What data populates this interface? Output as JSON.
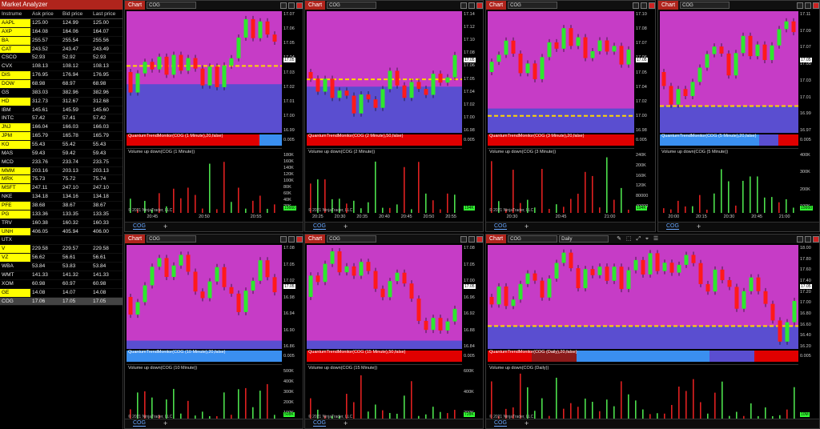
{
  "market_analyzer": {
    "title": "Market Analyzer",
    "columns": [
      "Instrume",
      "Ask price",
      "Bid price",
      "Last price"
    ],
    "rows": [
      {
        "sym": "AAPL",
        "ask": "125.00",
        "bid": "124.99",
        "last": "125.00",
        "hl": true
      },
      {
        "sym": "AXP",
        "ask": "164.08",
        "bid": "164.06",
        "last": "164.07",
        "hl": true
      },
      {
        "sym": "BA",
        "ask": "255.57",
        "bid": "255.54",
        "last": "255.56",
        "hl": true
      },
      {
        "sym": "CAT",
        "ask": "243.52",
        "bid": "243.47",
        "last": "243.49",
        "hl": true
      },
      {
        "sym": "CSCO",
        "ask": "52.93",
        "bid": "52.92",
        "last": "52.93",
        "hl": false
      },
      {
        "sym": "CVX",
        "ask": "108.13",
        "bid": "108.12",
        "last": "108.13",
        "hl": false
      },
      {
        "sym": "DIS",
        "ask": "176.95",
        "bid": "176.94",
        "last": "176.95",
        "hl": true
      },
      {
        "sym": "DOW",
        "ask": "68.98",
        "bid": "68.97",
        "last": "68.98",
        "hl": true
      },
      {
        "sym": "GS",
        "ask": "383.03",
        "bid": "382.96",
        "last": "382.96",
        "hl": false
      },
      {
        "sym": "HD",
        "ask": "312.73",
        "bid": "312.67",
        "last": "312.68",
        "hl": true
      },
      {
        "sym": "IBM",
        "ask": "145.61",
        "bid": "145.59",
        "last": "145.60",
        "hl": false
      },
      {
        "sym": "INTC",
        "ask": "57.42",
        "bid": "57.41",
        "last": "57.42",
        "hl": false
      },
      {
        "sym": "JNJ",
        "ask": "166.04",
        "bid": "166.03",
        "last": "166.03",
        "hl": true
      },
      {
        "sym": "JPM",
        "ask": "165.79",
        "bid": "165.78",
        "last": "165.79",
        "hl": true
      },
      {
        "sym": "KO",
        "ask": "55.43",
        "bid": "55.42",
        "last": "55.43",
        "hl": true
      },
      {
        "sym": "MAS",
        "ask": "59.43",
        "bid": "59.42",
        "last": "59.43",
        "hl": false
      },
      {
        "sym": "MCD",
        "ask": "233.76",
        "bid": "233.74",
        "last": "233.75",
        "hl": false
      },
      {
        "sym": "MMM",
        "ask": "203.16",
        "bid": "203.13",
        "last": "203.13",
        "hl": true
      },
      {
        "sym": "MRK",
        "ask": "75.73",
        "bid": "75.72",
        "last": "75.74",
        "hl": true
      },
      {
        "sym": "MSFT",
        "ask": "247.11",
        "bid": "247.10",
        "last": "247.10",
        "hl": true
      },
      {
        "sym": "NKE",
        "ask": "134.18",
        "bid": "134.16",
        "last": "134.18",
        "hl": false
      },
      {
        "sym": "PFE",
        "ask": "38.68",
        "bid": "38.67",
        "last": "38.67",
        "hl": true
      },
      {
        "sym": "PG",
        "ask": "133.36",
        "bid": "133.35",
        "last": "133.35",
        "hl": true
      },
      {
        "sym": "TRV",
        "ask": "160.38",
        "bid": "160.32",
        "last": "160.33",
        "hl": false
      },
      {
        "sym": "UNH",
        "ask": "406.05",
        "bid": "405.94",
        "last": "406.00",
        "hl": true
      },
      {
        "sym": "UTX",
        "ask": "",
        "bid": "",
        "last": "",
        "hl": false
      },
      {
        "sym": "V",
        "ask": "229.58",
        "bid": "229.57",
        "last": "229.58",
        "hl": true
      },
      {
        "sym": "VZ",
        "ask": "56.62",
        "bid": "56.61",
        "last": "56.61",
        "hl": true
      },
      {
        "sym": "WBA",
        "ask": "53.84",
        "bid": "53.83",
        "last": "53.84",
        "hl": false
      },
      {
        "sym": "WMT",
        "ask": "141.33",
        "bid": "141.32",
        "last": "141.33",
        "hl": false
      },
      {
        "sym": "XOM",
        "ask": "60.98",
        "bid": "60.97",
        "last": "60.98",
        "hl": false
      },
      {
        "sym": "GE",
        "ask": "14.08",
        "bid": "14.07",
        "last": "14.08",
        "hl": true
      },
      {
        "sym": "COG",
        "ask": "17.06",
        "bid": "17.05",
        "last": "17.05",
        "hl": false,
        "sel": true
      }
    ]
  },
  "charts": [
    {
      "label": "Chart",
      "symbol": "COG",
      "tab": "COG",
      "text": "QuantumDynamicVolatility(COG (1 Minute),false,30,0), QuantumVPOC(COG (1 Minute),60,50,false,true,true,EIGHT), QuantumDynamicPricePivots(COG (1 Minute),false,10), QuantumDynamicAccumulationAndDistribution(COG (1 Minute),0,Dash,0,100)",
      "qtm": "QuantumTrendMonitor(COG (1 Minute),20,false)",
      "qtm_val": "0.005",
      "vol": "Volume up down(COG (1 Minute))",
      "vol_badge": "15660",
      "copyright": "© 2021 NinjaTrader, LLC",
      "price_ticks": [
        "17.07",
        "17.06",
        "17.05",
        "17.04",
        "17.03",
        "17.02",
        "17.01",
        "17.00",
        "16.99"
      ],
      "price_badge": "17.05",
      "vol_ticks": [
        "180K",
        "160K",
        "140K",
        "120K",
        "100K",
        "80K",
        "60K",
        "40K",
        "20K"
      ],
      "x_ticks": [
        "20:45",
        "20:50",
        "20:55"
      ]
    },
    {
      "label": "Chart",
      "symbol": "COG",
      "tab": "COG",
      "text": "QuantumDynamicVolatility(COG (2 Minute),false,30,0), QuantumVPOC(COG (2 Minute),60,50,false,true,true,EIGHT), QuantumDynamicPricePivots(COG (2 Minute),false,10), QuantumDynamicAccumulationAndDistribution(COG (2 Minute),0,Dash,0,100)",
      "qtm": "QuantumTrendMonitor(COG (2 Minute),50,false)",
      "qtm_val": "0.005",
      "vol": "Volume up down(COG (2 Minute))",
      "vol_badge": "194K",
      "copyright": "© 2021 NinjaTrader, LLC",
      "price_ticks": [
        "17.14",
        "17.12",
        "17.10",
        "17.08",
        "17.06",
        "17.05",
        "17.04",
        "17.02",
        "17.00",
        "16.98"
      ],
      "price_badge": "17.05",
      "vol_ticks": [
        "",
        "",
        "",
        "",
        "",
        "",
        "",
        "",
        ""
      ],
      "x_ticks": [
        "20:25",
        "20:30",
        "20:35",
        "20:40",
        "20:45",
        "20:50",
        "20:55"
      ]
    },
    {
      "label": "Chart",
      "symbol": "COG",
      "tab": "COG",
      "text": "QuantumDynamicVolatility(COG (3 Minute),false,30,0), QuantumVPOC(COG (3 Minute),60,50,false,true,true,EIGHT), QuantumDynamicPricePivots(COG (3 Minute),false,10), QuantumDynamicAccumulationAndDistribution(COG (3 Minute),0,Dash,0,100)",
      "qtm": "QuantumTrendMonitor(COG (3 Minute),20,false)",
      "qtm_val": "0.005",
      "vol": "Volume up down(COG (3 Minute))",
      "vol_badge": "194K",
      "copyright": "© 2021 NinjaTrader, LLC",
      "price_ticks": [
        "17.10",
        "17.08",
        "17.07",
        "17.06",
        "17.05",
        "17.04",
        "17.02",
        "17.00",
        "16.98"
      ],
      "price_badge": "17.05",
      "vol_ticks": [
        "240K",
        "200K",
        "160K",
        "120K",
        "80000",
        "40000"
      ],
      "x_ticks": [
        "20:30",
        "20:45",
        "21:00"
      ]
    },
    {
      "label": "Chart",
      "symbol": "COG",
      "tab": "COG",
      "text": "QuantumDynamicVolatility(COG (5 Minute),false,30,0), QuantumVPOC(COG (5 Minute),60,50,false,true,true,EIGHT), QuantumDynamicPricePivots(COG (5 Minute),false,10), QuantumDynamicAccumulationAndDistribution(COG (5 Minute),0,Dash,0,100)",
      "qtm": "QuantumTrendMonitor(COG (5 Minute),20,false)",
      "qtm_val": "0.005",
      "vol": "Volume up down(COG (5 Minute))",
      "vol_badge": "15660",
      "copyright": "",
      "price_ticks": [
        "17.11",
        "17.09",
        "17.07",
        "17.05",
        "17.03",
        "17.01",
        "16.99",
        "16.97"
      ],
      "price_badge": "17.05",
      "vol_ticks": [
        "400K",
        "300K",
        "200K",
        "100K"
      ],
      "x_ticks": [
        "20:00",
        "20:15",
        "20:30",
        "20:45",
        "21:00"
      ]
    },
    {
      "label": "Chart",
      "symbol": "COG",
      "tab": "COG",
      "text": "QuantumDynamicVolatility(COG (10 Minute),false,30,0), QuantumVPOC(COG (10 Minute),60,50,false,true,true,EIGHT), QuantumDynamicPricePivots(COG (10 Minute),false,10), QuantumDynamicAccumulationAndDistribution(COG (10 Minute),0,Dash,0,100)",
      "qtm": "QuantumTrendMonitor(COG (10 Minute),20,false)",
      "qtm_val": "0.005",
      "vol": "Volume up down(COG (10 Minute))",
      "vol_badge": "508K",
      "copyright": "© 2021 NinjaTrader, LLC",
      "price_ticks": [
        "17.08",
        "17.05",
        "17.02",
        "16.98",
        "16.94",
        "16.90",
        "16.86"
      ],
      "price_badge": "17.05",
      "vol_ticks": [
        "500K",
        "400K",
        "300K",
        "200K",
        "100K"
      ],
      "x_ticks": [
        "19:30",
        "20:00",
        "20:30",
        "21:00"
      ]
    },
    {
      "label": "Chart",
      "symbol": "COG",
      "tab": "COG",
      "text": "QuantumDynamicVolatility(COG (15 Minute),false,30,0), QuantumVPOC(COG (15 Minute),60,50,false,true,true,EIGHT), QuantumDynamicPricePivots(COG (15 Minute),false,10), QuantumDynamicAccumulationAndDistribution(COG (15 Minute),0,Dash,0,100)",
      "qtm": "QuantumTrendMonitor(COG (15 Minute),50,false)",
      "qtm_val": "0.005",
      "vol": "Volume up down(COG (15 Minute))",
      "vol_badge": "728K",
      "copyright": "© 2021 NinjaTrader, LLC",
      "price_ticks": [
        "17.08",
        "17.05",
        "17.00",
        "16.96",
        "16.92",
        "16.88",
        "16.84"
      ],
      "price_badge": "17.05",
      "vol_ticks": [
        "600K",
        "400K",
        "200K"
      ],
      "x_ticks": [
        "19:00",
        "19:30",
        "20:00",
        "20:30",
        "21:00"
      ]
    },
    {
      "label": "Chart",
      "symbol": "COG",
      "tab": "COG",
      "interval": "Daily",
      "text": "QuantumDynamicVolatility(COG (Daily),false,30,0), QuantumVPOC(COG (Daily),60,50,false,true,true,EIGHT), QuantumDynamicPricePivots(COG (Daily),false,10), QuantumDynamicAccumulationAndDistribution(COG (Daily),0,Dash,0,100)",
      "qtm": "QuantumTrendMonitor(COG (Daily),20,false)",
      "qtm_val": "0.005",
      "vol": "Volume up down(COG (Daily))",
      "vol_badge": "10M",
      "copyright": "© 2021 NinjaTrader, LLC",
      "price_ticks": [
        "18.00",
        "17.80",
        "17.60",
        "17.40",
        "17.20",
        "17.00",
        "16.80",
        "16.60",
        "16.40",
        "16.20"
      ],
      "price_badge": "17.05",
      "vol_ticks": [
        "",
        "",
        ""
      ],
      "x_ticks": [
        "26",
        "M",
        "10",
        "17",
        "24",
        "J"
      ]
    }
  ]
}
